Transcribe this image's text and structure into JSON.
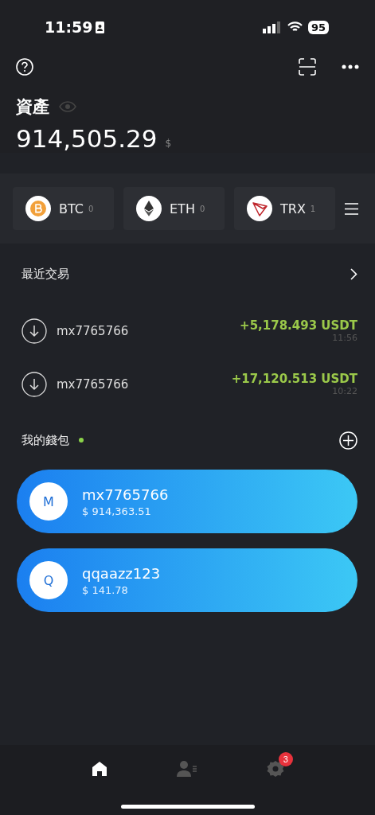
{
  "status_bar": {
    "time": "11:59",
    "battery": "95"
  },
  "assets": {
    "title": "資產",
    "total": "914,505.29",
    "currency": "$"
  },
  "coins": [
    {
      "kind": "btc",
      "symbol": "BTC",
      "balance": "0"
    },
    {
      "kind": "eth",
      "symbol": "ETH",
      "balance": "0"
    },
    {
      "kind": "trx",
      "symbol": "TRX",
      "balance": "1"
    }
  ],
  "recent": {
    "title": "最近交易",
    "transactions": [
      {
        "account": "mx7765766",
        "amount": "+5,178.493 USDT",
        "time": "11:56"
      },
      {
        "account": "mx7765766",
        "amount": "+17,120.513 USDT",
        "time": "10:22"
      }
    ]
  },
  "wallets": {
    "title": "我的錢包",
    "status_dot": true,
    "items": [
      {
        "initial": "M",
        "name": "mx7765766",
        "balance": "$ 914,363.51"
      },
      {
        "initial": "Q",
        "name": "qqaazz123",
        "balance": "$ 141.78"
      }
    ]
  },
  "tab_bar": {
    "tabs": [
      {
        "kind": "home",
        "selected": true
      },
      {
        "kind": "contacts",
        "selected": false
      },
      {
        "kind": "settings",
        "selected": false,
        "badge": "3"
      }
    ]
  }
}
